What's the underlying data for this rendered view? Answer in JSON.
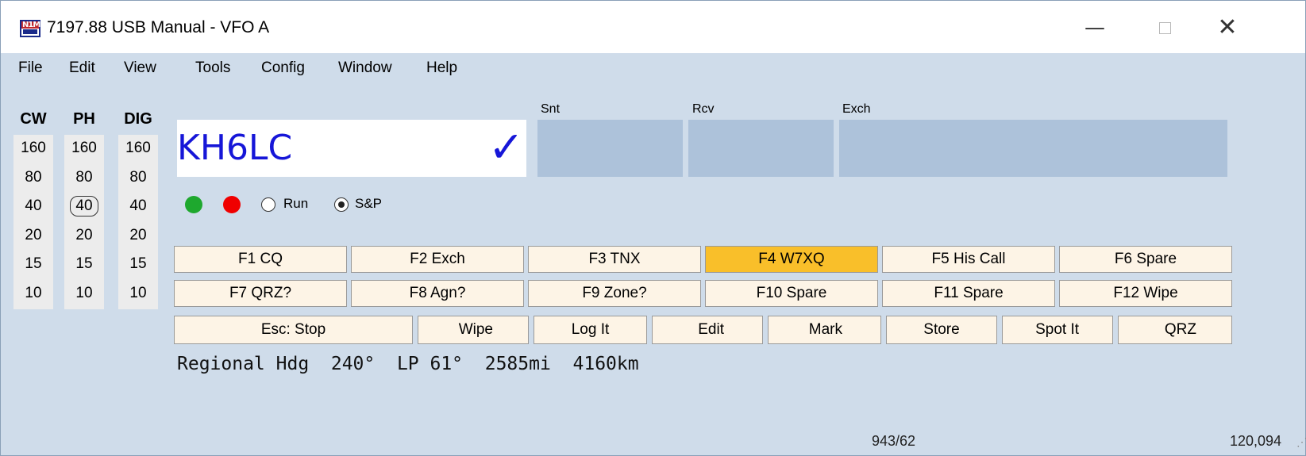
{
  "window": {
    "title": "7197.88 USB Manual - VFO A",
    "icon": "n1mm-logo-icon",
    "icon_text": "N1M",
    "controls": {
      "minimize": "—",
      "maximize": "□",
      "close": "✕"
    }
  },
  "menu": [
    "File",
    "Edit",
    "View",
    "Tools",
    "Config",
    "Window",
    "Help"
  ],
  "bands": {
    "columns": [
      {
        "header": "CW",
        "values": [
          "160",
          "80",
          "40",
          "20",
          "15",
          "10"
        ]
      },
      {
        "header": "PH",
        "values": [
          "160",
          "80",
          "40",
          "20",
          "15",
          "10"
        ]
      },
      {
        "header": "DIG",
        "values": [
          "160",
          "80",
          "40",
          "20",
          "15",
          "10"
        ]
      }
    ],
    "selected": {
      "column": "PH",
      "value": "40"
    }
  },
  "entry": {
    "callsign": "KH6LC",
    "check_mark": "✓",
    "snt_label": "Snt",
    "rcv_label": "Rcv",
    "exch_label": "Exch",
    "snt_value": "",
    "rcv_value": "",
    "exch_value": ""
  },
  "mode": {
    "run_label": "Run",
    "sp_label": "S&P",
    "selected": "S&P",
    "colors": {
      "green": "#1ea82e",
      "red": "#f00000"
    }
  },
  "function_keys": {
    "row1": [
      "F1 CQ",
      "F2 Exch",
      "F3 TNX",
      "F4 W7XQ",
      "F5 His Call",
      "F6 Spare"
    ],
    "row2": [
      "F7 QRZ?",
      "F8 Agn?",
      "F9 Zone?",
      "F10 Spare",
      "F11 Spare",
      "F12 Wipe"
    ],
    "active": "F4 W7XQ",
    "active_color": "#f9bf2a"
  },
  "buttons": {
    "esc_stop": "Esc: Stop",
    "wipe": "Wipe",
    "log_it": "Log It",
    "edit": "Edit",
    "mark": "Mark",
    "store": "Store",
    "spot_it": "Spot It",
    "qrz": "QRZ"
  },
  "info": "Regional Hdg  240°  LP 61°  2585mi  4160km",
  "status": {
    "qso_count": "943/62",
    "score": "120,094"
  }
}
